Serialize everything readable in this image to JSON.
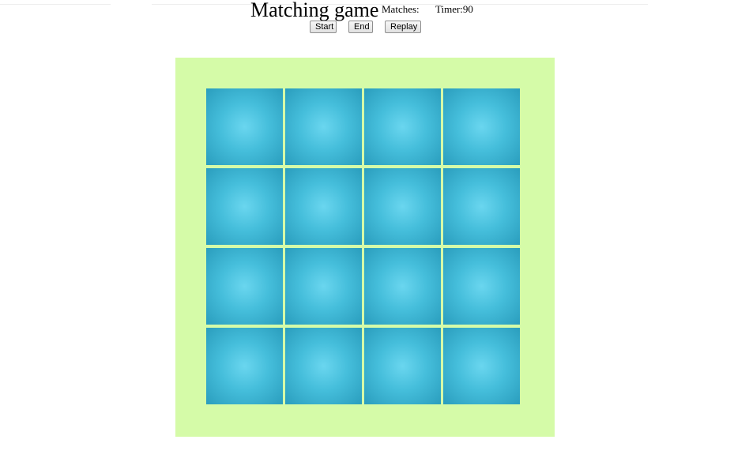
{
  "header": {
    "title": "Matching game",
    "matches_label": "Matches:",
    "timer_label": "Timer:90"
  },
  "controls": {
    "start_label": "Start",
    "end_label": "End",
    "replay_label": "Replay"
  },
  "board": {
    "rows": 4,
    "columns": 4,
    "background_color": "#d5fba8",
    "card_back_color": "#45bedb",
    "cards_face_down": 16
  }
}
